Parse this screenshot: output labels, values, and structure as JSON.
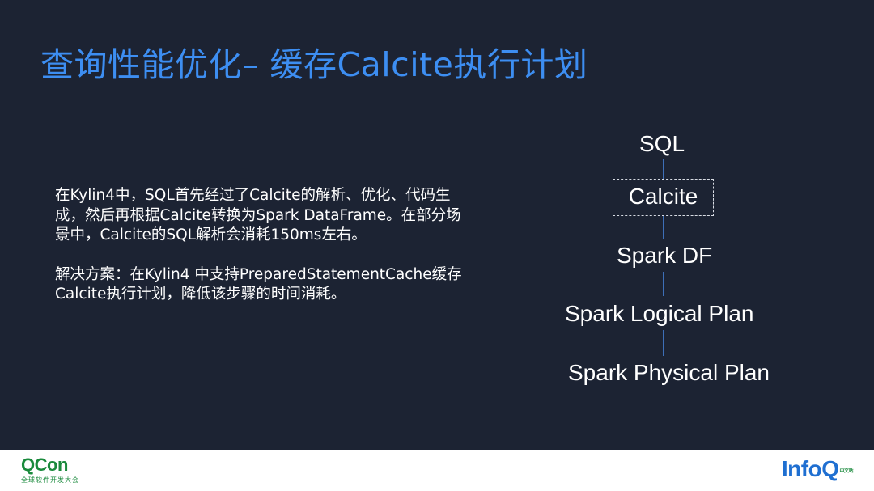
{
  "title": "查询性能优化– 缓存Calcite执行计划",
  "body": {
    "para1": "在Kylin4中，SQL首先经过了Calcite的解析、优化、代码生成，然后再根据Calcite转换为Spark DataFrame。在部分场景中，Calcite的SQL解析会消耗150ms左右。",
    "para2": "解决方案：在Kylin4 中支持PreparedStatementCache缓存Calcite执行计划，降低该步骤的时间消耗。"
  },
  "flow": {
    "nodes": [
      "SQL",
      "Calcite",
      "Spark DF",
      "Spark Logical Plan",
      "Spark Physical Plan"
    ]
  },
  "footer": {
    "left_logo": "QCon",
    "left_subtitle": "全球软件开发大会",
    "right_logo": "InfoQ",
    "right_mark": "中文站"
  },
  "colors": {
    "background": "#1c2333",
    "title": "#3d8ef2",
    "connector": "#3d6fb8",
    "qcon_green": "#1a8a3c",
    "infoq_blue": "#1f6fd1"
  }
}
